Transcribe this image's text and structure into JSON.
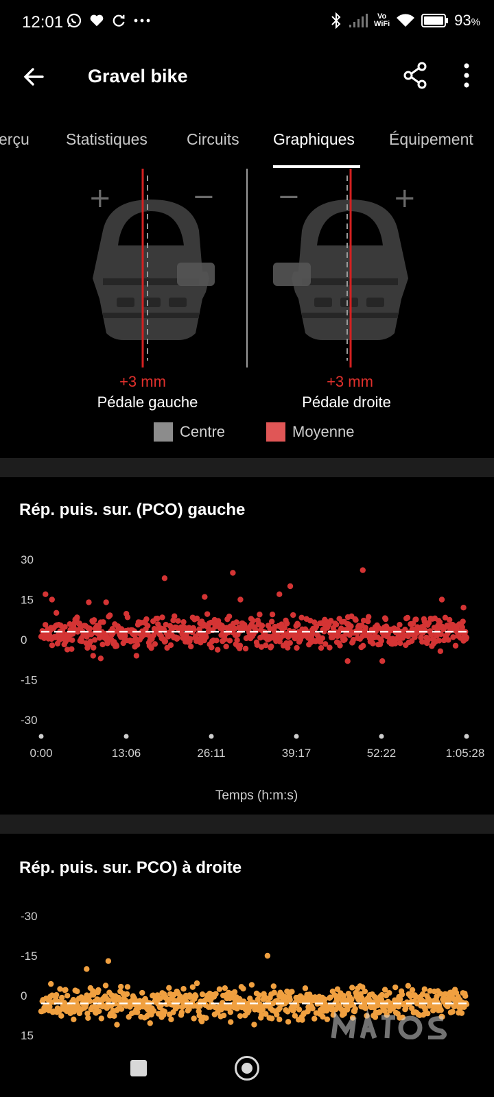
{
  "status_bar": {
    "time": "12:01",
    "battery": "93",
    "battery_unit": "%",
    "vowifi_top": "Vo",
    "vowifi_bottom": "WiFi",
    "icons": [
      "whatsapp-icon",
      "heart-icon",
      "sync-icon",
      "more-dots-icon",
      "bluetooth-icon",
      "signal-icon",
      "vowifi-icon",
      "wifi-icon",
      "battery-icon"
    ]
  },
  "app_bar": {
    "title": "Gravel bike",
    "icons": [
      "back-arrow-icon",
      "share-icon",
      "more-vert-icon"
    ]
  },
  "tabs": [
    {
      "label": "Aperçu",
      "visible_text": "erçu",
      "active": false
    },
    {
      "label": "Statistiques",
      "active": false
    },
    {
      "label": "Circuits",
      "active": false
    },
    {
      "label": "Graphiques",
      "active": true
    },
    {
      "label": "Équipement",
      "active": false
    }
  ],
  "pedals": {
    "left": {
      "value": "+3 mm",
      "label": "Pédale gauche",
      "plus": "+",
      "minus": "−"
    },
    "right": {
      "value": "+3 mm",
      "label": "Pédale droite",
      "plus": "+",
      "minus": "−"
    },
    "legend": [
      {
        "label": "Centre",
        "color": "#8c8c8c"
      },
      {
        "label": "Moyenne",
        "color": "#e05656"
      }
    ],
    "colors": {
      "average_line": "#d42020",
      "center_line": "#9a9a9a"
    }
  },
  "chart_data": [
    {
      "type": "scatter",
      "title": "Rép. puis. sur. (PCO) gauche",
      "xlabel": "Temps (h:m:s)",
      "ylabel": "",
      "x_ticks": [
        "0:00",
        "13:06",
        "26:11",
        "39:17",
        "52:22",
        "1:05:28"
      ],
      "x_range_seconds": [
        0,
        3928
      ],
      "y_ticks": [
        30,
        15,
        0,
        -15,
        -30
      ],
      "ylim": [
        -30,
        30
      ],
      "average_line": 3,
      "point_color": "#d43434",
      "band": {
        "center": 3,
        "spread": 4
      },
      "outliers": [
        {
          "x": 40,
          "y": 17
        },
        {
          "x": 100,
          "y": 15
        },
        {
          "x": 330,
          "y": 8
        },
        {
          "x": 440,
          "y": 14
        },
        {
          "x": 600,
          "y": 14
        },
        {
          "x": 1140,
          "y": 23
        },
        {
          "x": 1510,
          "y": 16
        },
        {
          "x": 1770,
          "y": 25
        },
        {
          "x": 1840,
          "y": 15
        },
        {
          "x": 2200,
          "y": 17
        },
        {
          "x": 2300,
          "y": 20
        },
        {
          "x": 2830,
          "y": -8
        },
        {
          "x": 2970,
          "y": 26
        },
        {
          "x": 3150,
          "y": -8
        },
        {
          "x": 3700,
          "y": 15
        },
        {
          "x": 3900,
          "y": 12
        },
        {
          "x": 550,
          "y": -7
        },
        {
          "x": 480,
          "y": -6
        },
        {
          "x": 880,
          "y": -6
        }
      ]
    },
    {
      "type": "scatter",
      "title": "Rép. puis. sur. PCO) à droite",
      "xlabel": "",
      "ylabel": "",
      "y_ticks": [
        -30,
        -15,
        0,
        15
      ],
      "ylim": [
        -30,
        15
      ],
      "y_inverted": true,
      "average_line": 3,
      "point_color": "#f0a040",
      "band": {
        "center": 3,
        "spread": 4
      },
      "outliers": [
        {
          "x": 420,
          "y": -10
        },
        {
          "x": 620,
          "y": -13
        },
        {
          "x": 2090,
          "y": -15
        },
        {
          "x": 300,
          "y": 9
        },
        {
          "x": 700,
          "y": 11
        },
        {
          "x": 1200,
          "y": 9
        },
        {
          "x": 1750,
          "y": 10
        },
        {
          "x": 2200,
          "y": 9
        },
        {
          "x": 2600,
          "y": 8
        }
      ]
    }
  ],
  "nav_bar": {
    "icons": [
      "recents-square-icon",
      "home-circle-icon"
    ]
  },
  "watermark": {
    "text": "matos velo"
  }
}
